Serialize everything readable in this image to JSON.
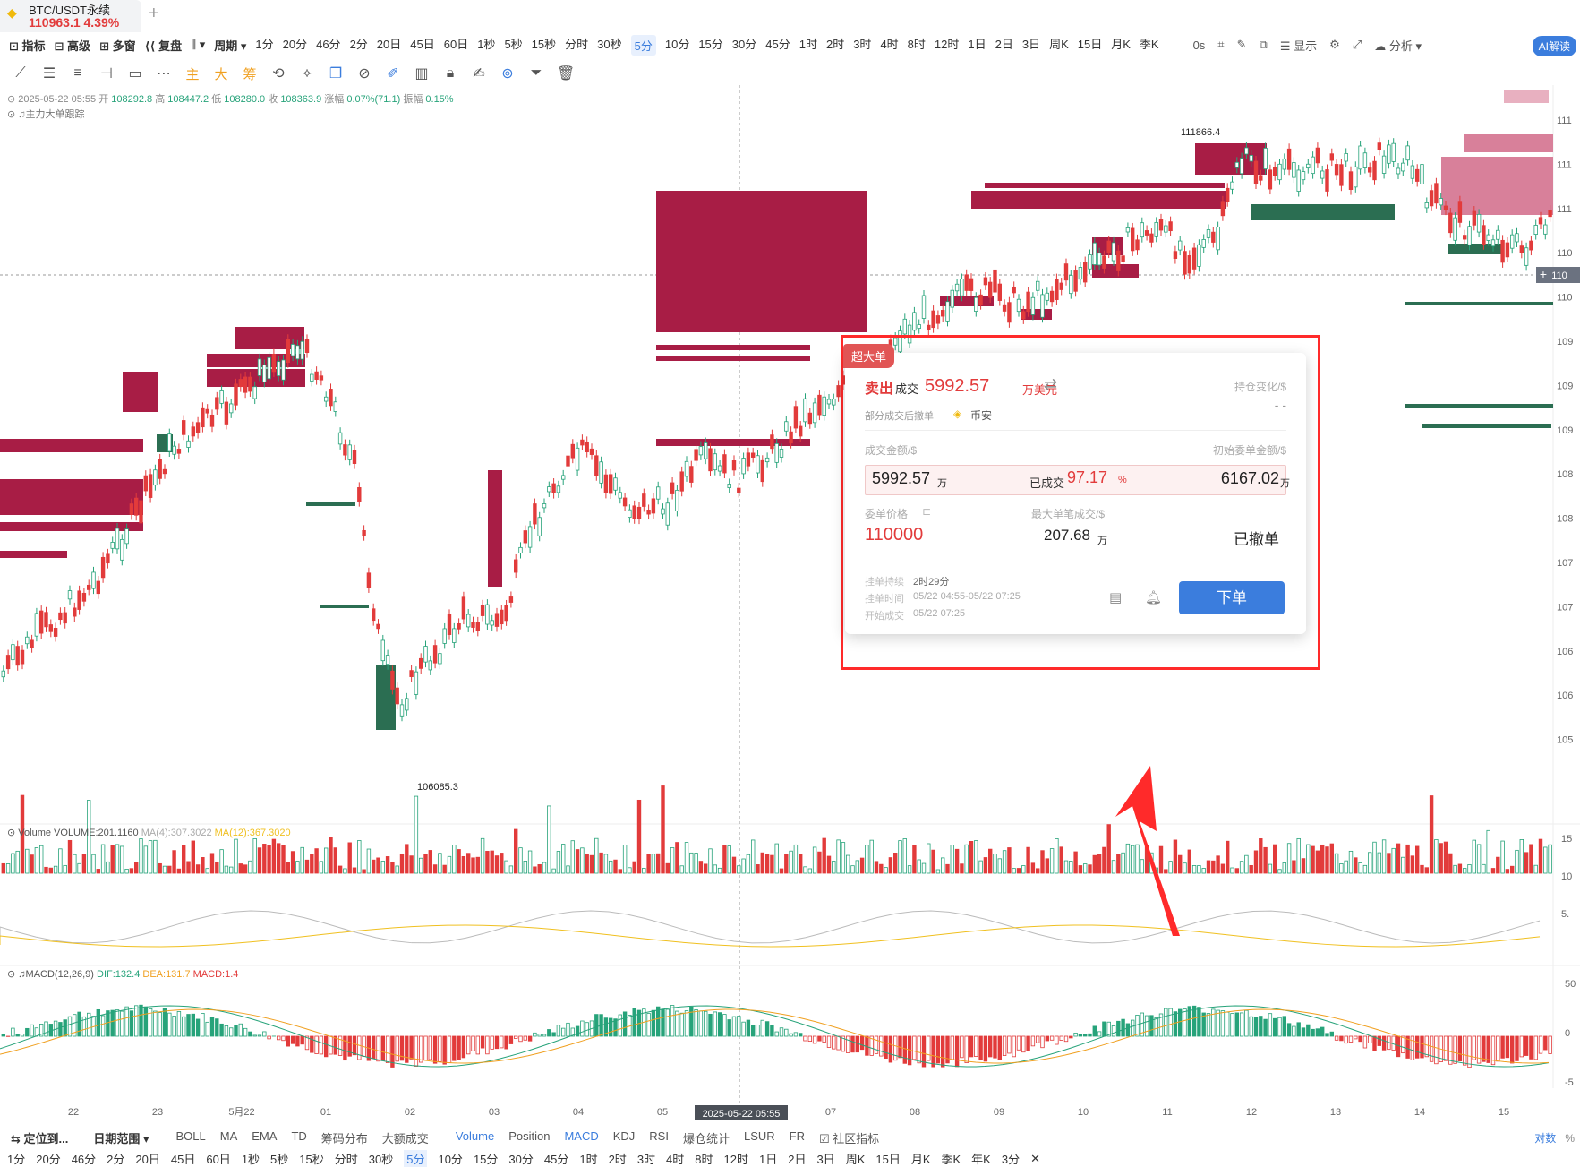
{
  "tab": {
    "symbol": "BTC/USDT永续",
    "price": "110963.1",
    "change": "4.39%",
    "add_label": "+"
  },
  "toolbar1": {
    "items": [
      "指标",
      "高级",
      "多窗",
      "复盘"
    ],
    "period_label": "周期",
    "periods": [
      "1分",
      "20分",
      "46分",
      "2分",
      "20日",
      "45日",
      "60日",
      "1秒",
      "5秒",
      "15秒",
      "分时",
      "30秒",
      "5分",
      "10分",
      "15分",
      "30分",
      "45分",
      "1时",
      "2时",
      "3时",
      "4时",
      "8时",
      "12时",
      "1日",
      "2日",
      "3日",
      "周K",
      "15日",
      "月K",
      "季K"
    ],
    "active_period": "5分",
    "right_items": [
      "0s",
      "显示",
      "分析"
    ],
    "ai_label": "AI解读"
  },
  "ohlc": {
    "date": "2025-05-22 05:55",
    "open_label": "开",
    "open": "108292.8",
    "high_label": "高",
    "high": "108447.2",
    "low_label": "低",
    "low": "108280.0",
    "close_label": "收",
    "close": "108363.9",
    "change_label": "涨幅",
    "change": "0.07%(71.1)",
    "amp_label": "振幅",
    "amp": "0.15%",
    "sub_label": "主力大单跟踪"
  },
  "chart_data": {
    "type": "candlestick",
    "price_labels": [
      "111",
      "111",
      "111",
      "110",
      "110",
      "109",
      "109",
      "109",
      "108",
      "108",
      "107",
      "107",
      "106",
      "106",
      "105"
    ],
    "annotations": [
      "111866.4",
      "106085.3"
    ],
    "high_marker": "111866.4",
    "low_marker": "106085.3",
    "x_tick_labels": [
      "22",
      "23",
      "5月22",
      "01",
      "02",
      "03",
      "04",
      "05",
      "07",
      "08",
      "09",
      "10",
      "11",
      "12",
      "13",
      "14",
      "15"
    ],
    "crosshair_date": "2025-05-22 05:55",
    "current_price_tag": "110",
    "volume": {
      "title": "Volume",
      "volume_label": "VOLUME:201.1160",
      "ma4": "MA(4):307.3022",
      "ma12": "MA(12):367.3020",
      "axis_labels": [
        "15",
        "10",
        "5."
      ]
    },
    "macd": {
      "title": "MACD(12,26,9)",
      "dif": "DIF:132.4",
      "dea": "DEA:131.7",
      "macd": "MACD:1.4",
      "axis_labels": [
        "50",
        "0",
        "-5"
      ]
    }
  },
  "popup": {
    "tag": "超大单",
    "side": "卖出",
    "deal": "成交",
    "amount": "5992.57",
    "amount_unit": "万美元",
    "position_change_label": "持仓变化/$",
    "position_change_value": "- -",
    "partial_note": "部分成交后撤单",
    "exchange": "币安",
    "trade_amount_label": "成交金额/$",
    "trade_amount": "5992.57",
    "trade_amount_unit": "万",
    "filled_label": "已成交",
    "filled_pct": "97.17",
    "filled_unit": "%",
    "initial_label": "初始委单金额/$",
    "initial_amount": "6167.02",
    "initial_unit": "万",
    "order_price_label": "委单价格",
    "order_price": "110000",
    "max_single_label": "最大单笔成交/$",
    "max_single": "207.68",
    "max_single_unit": "万",
    "status": "已撤单",
    "duration_label": "挂单持续",
    "duration": "2时29分",
    "time_label": "挂单时间",
    "time": "05/22 04:55-05/22 07:25",
    "start_label": "开始成交",
    "start": "05/22 07:25",
    "order_button": "下单"
  },
  "bottom1": {
    "locate": "定位到...",
    "date_range": "日期范围",
    "indicators": [
      "BOLL",
      "MA",
      "EMA",
      "TD",
      "筹码分布",
      "大额成交"
    ],
    "sub_indicators": [
      "Volume",
      "Position",
      "MACD",
      "KDJ",
      "RSI",
      "爆仓统计",
      "LSUR",
      "FR"
    ],
    "community": "社区指标",
    "right_label": "对数",
    "pct_label": "%"
  },
  "bottom2": {
    "periods": [
      "1分",
      "20分",
      "46分",
      "2分",
      "20日",
      "45日",
      "60日",
      "1秒",
      "5秒",
      "15秒",
      "分时",
      "30秒",
      "5分",
      "10分",
      "15分",
      "30分",
      "45分",
      "1时",
      "2时",
      "3时",
      "4时",
      "8时",
      "12时",
      "1日",
      "2日",
      "3日",
      "周K",
      "15日",
      "月K",
      "季K",
      "年K",
      "3分"
    ],
    "active": "5分",
    "close": "✕"
  },
  "colors": {
    "up": "#27a37a",
    "down": "#e23b3b",
    "big_sell": "#a81d45",
    "big_buy": "#2b6e52",
    "accent": "#3b7ddd",
    "highlight_frame": "#ff2a2a"
  }
}
